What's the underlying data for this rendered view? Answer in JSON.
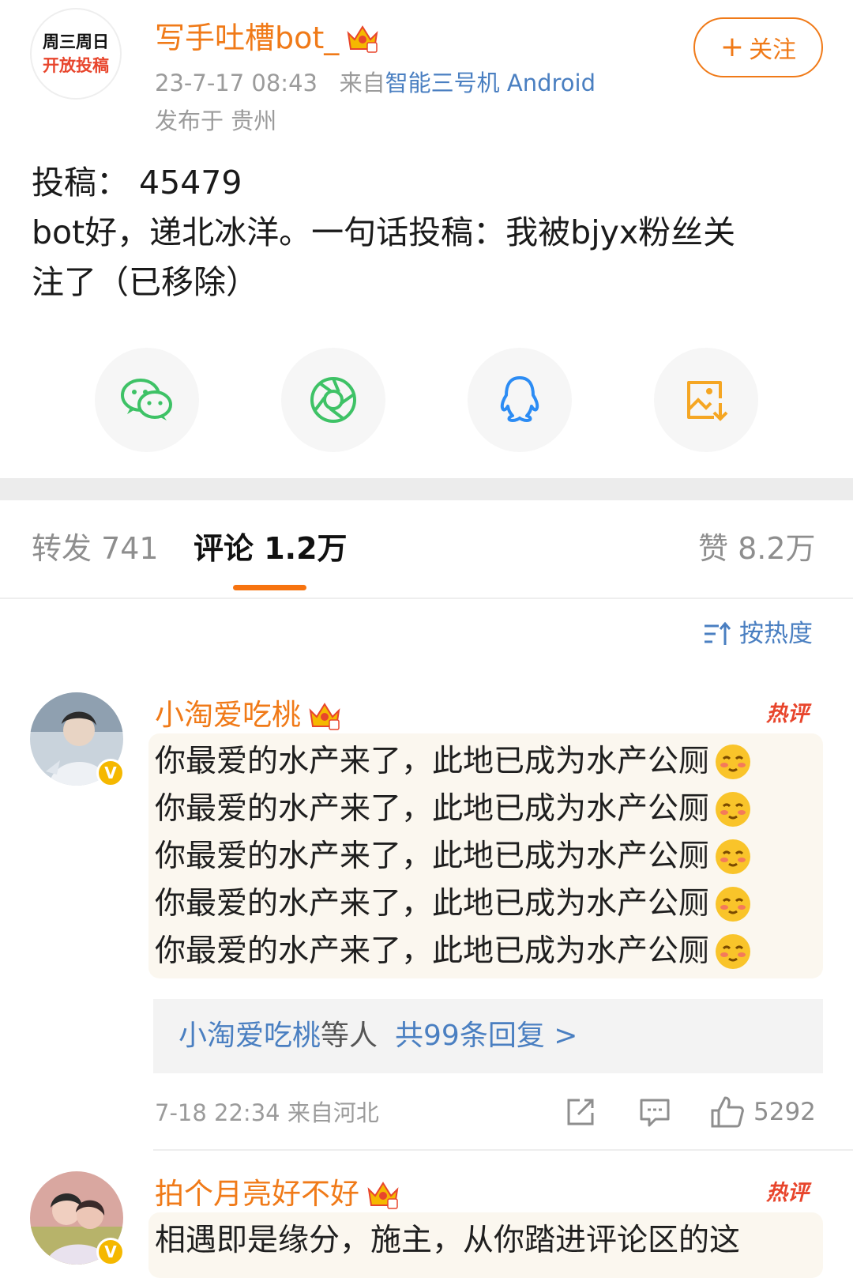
{
  "post": {
    "avatar_line1": "周三周日",
    "avatar_line2": "开放投稿",
    "author": "写手吐槽bot_",
    "time": "23-7-17 08:43",
    "source_prefix": "来自",
    "source": "智能三号机 Android",
    "location": "发布于 贵州",
    "follow_plus": "+",
    "follow_label": "关注",
    "text_line1": "投稿：  45479",
    "text_line2": "bot好，递北冰洋。一句话投稿：我被bjyx粉丝关",
    "text_line3": "注了（已移除）"
  },
  "share": {
    "items": [
      {
        "icon": "wechat-icon",
        "color": "#3ec266"
      },
      {
        "icon": "moments-icon",
        "color": "#3ec266"
      },
      {
        "icon": "qq-icon",
        "color": "#2c8cf4"
      },
      {
        "icon": "save-image-icon",
        "color": "#f5a623"
      }
    ]
  },
  "tabs": {
    "repost": "转发 741",
    "comments": "评论 1.2万",
    "likes": "赞 8.2万"
  },
  "sort": {
    "label": "按热度"
  },
  "comments": [
    {
      "name": "小淘爱吃桃",
      "verified": "V",
      "hot": "热评",
      "lines": [
        "你最爱的水产来了，此地已成为水产公厕",
        "你最爱的水产来了，此地已成为水产公厕",
        "你最爱的水产来了，此地已成为水产公厕",
        "你最爱的水产来了，此地已成为水产公厕",
        "你最爱的水产来了，此地已成为水产公厕"
      ],
      "emoji": "blush-emoji",
      "reply_who": "小淘爱吃桃",
      "reply_etc": "等人",
      "reply_count": "共99条回复 >",
      "time": "7-18 22:34 来自河北",
      "likes": "5292"
    },
    {
      "name": "拍个月亮好不好",
      "verified": "V",
      "hot": "热评",
      "lines": [
        "相遇即是缘分，施主，从你踏进评论区的这"
      ]
    }
  ],
  "colors": {
    "brand_orange": "#f07a18",
    "link_blue": "#4a7fc1",
    "hot_red": "#e8452c",
    "muted": "#9b9b9b"
  }
}
